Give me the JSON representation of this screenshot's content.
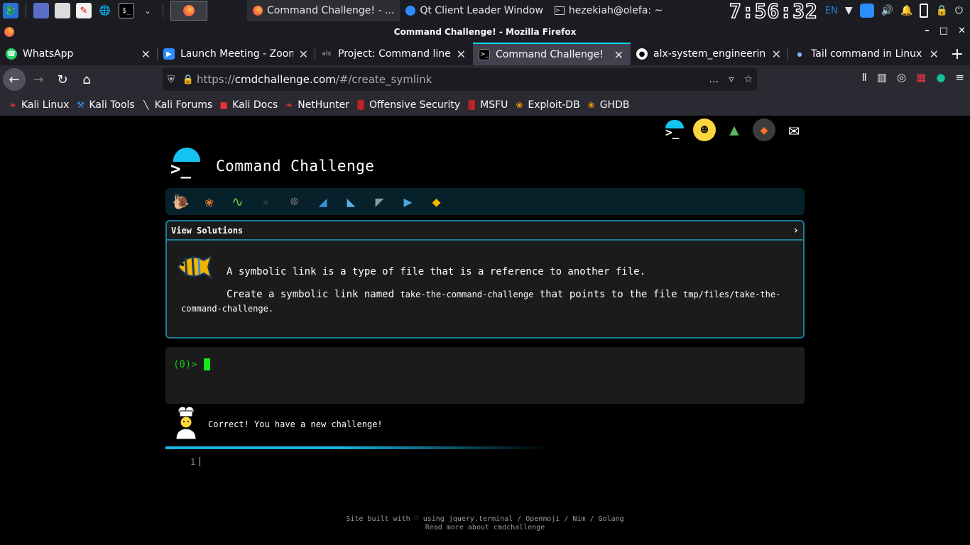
{
  "taskbar": {
    "tasks": [
      {
        "label": "Command Challenge! - ..."
      },
      {
        "label": "Qt Client Leader Window"
      },
      {
        "label": "hezekiah@olefa: ~"
      }
    ],
    "clock": "7:56:32",
    "lang": "EN"
  },
  "window": {
    "title": "Command Challenge! - Mozilla Firefox"
  },
  "tabs": [
    {
      "label": "WhatsApp",
      "icon": "whatsapp-icon"
    },
    {
      "label": "Launch Meeting - Zoom",
      "icon": "zoom-icon"
    },
    {
      "label": "Project: Command line fo",
      "icon": "alx-icon"
    },
    {
      "label": "Command Challenge!",
      "icon": "terminal-icon"
    },
    {
      "label": "alx-system_engineering",
      "icon": "github-icon"
    },
    {
      "label": "Tail command in Linux w",
      "icon": "dot-icon"
    }
  ],
  "url": {
    "proto": "https://",
    "host": "cmdchallenge.com",
    "path": "/#/create_symlink"
  },
  "bookmarks": [
    {
      "label": "Kali Linux"
    },
    {
      "label": "Kali Tools"
    },
    {
      "label": "Kali Forums"
    },
    {
      "label": "Kali Docs"
    },
    {
      "label": "NetHunter"
    },
    {
      "label": "Offensive Security"
    },
    {
      "label": "MSFU"
    },
    {
      "label": "Exploit-DB"
    },
    {
      "label": "GHDB"
    }
  ],
  "site": {
    "brand": "Command Challenge",
    "solutions_label": "View Solutions",
    "desc_line1": "A symbolic link is a type of file that is a reference to another file.",
    "desc_create": "Create a symbolic link named",
    "link_name": "take-the-command-challenge",
    "desc_points": "that points to the file",
    "target_file": "tmp/files/take-the-command-challenge.",
    "prompt": "(0)>",
    "result": "Correct! You have a new challenge!",
    "line_number": "1",
    "footer_line1": "Site built with ♡ using jquery.terminal / Openmoji / Nim / Golang",
    "footer_line2": "Read more about cmdchallenge"
  },
  "colors": {
    "accent": "#1a7f9b",
    "prompt_green": "#17c717",
    "tab_highlight": "#00ddff"
  }
}
